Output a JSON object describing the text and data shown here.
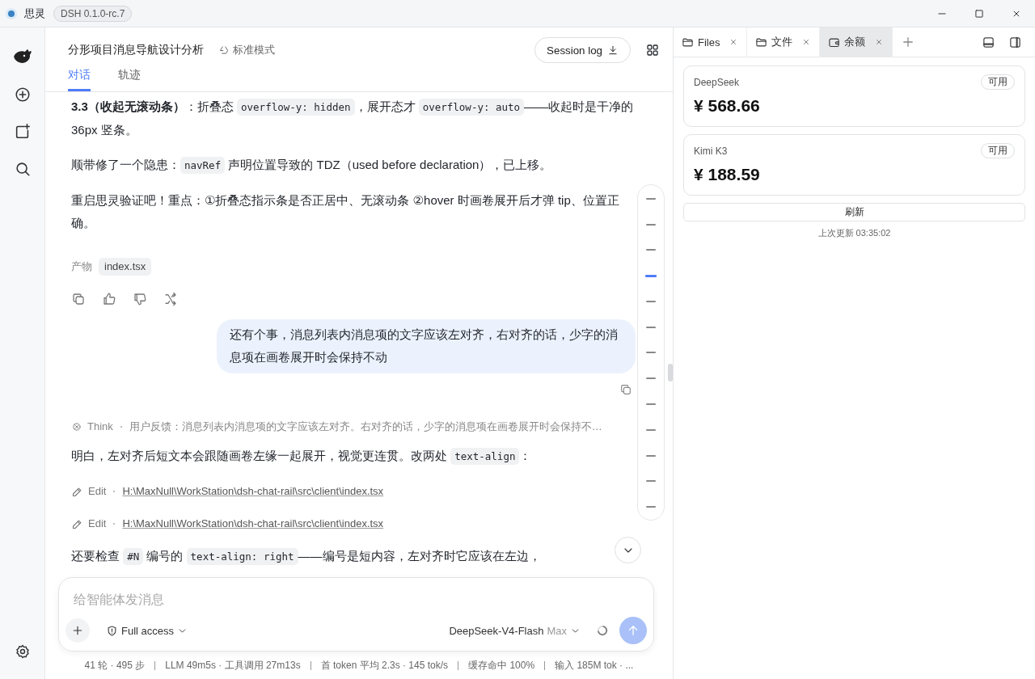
{
  "titlebar": {
    "app_name": "思灵",
    "version": "DSH 0.1.0-rc.7"
  },
  "header": {
    "title": "分形项目消息导航设计分析",
    "mode": "标准模式",
    "session_button": "Session log",
    "tabs": [
      {
        "label": "对话",
        "selected": true
      },
      {
        "label": "轨迹",
        "selected": false
      }
    ]
  },
  "messages": [
    {
      "kind": "paragraph",
      "parts": [
        {
          "kind": "text",
          "text": "**3.3（收起无滚动条）**：折叠态 "
        },
        {
          "kind": "code",
          "text": "overflow-y: hidden"
        },
        {
          "kind": "text",
          "text": "，展开态才 "
        },
        {
          "kind": "code",
          "text": "overflow-y: auto"
        },
        {
          "kind": "text",
          "text": "——收起时是干净的 36px 竖条。"
        }
      ]
    },
    {
      "kind": "paragraph",
      "parts": [
        {
          "kind": "text",
          "text": "顺带修了一个隐患："
        },
        {
          "kind": "code",
          "text": "navRef"
        },
        {
          "kind": "text",
          "text": " 声明位置导致的 TDZ（used before declaration），已上移。"
        }
      ]
    },
    {
      "kind": "paragraph",
      "parts": [
        {
          "kind": "text",
          "text": "重启思灵验证吧！重点：①折叠态指示条是否正居中、无滚动条 ②hover 时画卷展开后才弹 tip、位置正确。"
        }
      ]
    },
    {
      "kind": "artifacts",
      "label": "产物",
      "files": [
        "index.tsx"
      ]
    },
    {
      "kind": "actions"
    },
    {
      "kind": "user",
      "text": "还有个事，消息列表内消息项的文字应该左对齐，右对齐的话，少字的消息项在画卷展开时会保持不动"
    },
    {
      "kind": "think",
      "label": "Think",
      "text": "用户反馈：消息列表内消息项的文字应该左对齐。右对齐的话，少字的消息项在画卷展开时会保持不…"
    },
    {
      "kind": "paragraph",
      "parts": [
        {
          "kind": "text",
          "text": "明白，左对齐后短文本会跟随画卷左缘一起展开，视觉更连贯。改两处 "
        },
        {
          "kind": "code",
          "text": "text-align"
        },
        {
          "kind": "text",
          "text": "："
        }
      ]
    },
    {
      "kind": "edit",
      "label": "Edit",
      "path": "H:\\MaxNull\\WorkStation\\dsh-chat-rail\\src\\client\\index.tsx"
    },
    {
      "kind": "edit",
      "label": "Edit",
      "path": "H:\\MaxNull\\WorkStation\\dsh-chat-rail\\src\\client\\index.tsx"
    },
    {
      "kind": "paragraph",
      "parts": [
        {
          "kind": "text",
          "text": "还要检查 "
        },
        {
          "kind": "code",
          "text": "#N"
        },
        {
          "kind": "text",
          "text": " 编号的 "
        },
        {
          "kind": "code",
          "text": "text-align: right"
        },
        {
          "kind": "text",
          "text": "——编号是短内容，左对齐时它应该在左边，"
        }
      ]
    }
  ],
  "nav_rail": [
    {
      "selected": false
    },
    {
      "selected": false
    },
    {
      "selected": false
    },
    {
      "selected": true
    },
    {
      "selected": false
    },
    {
      "selected": false
    },
    {
      "selected": false
    },
    {
      "selected": false
    },
    {
      "selected": false
    },
    {
      "selected": false
    },
    {
      "selected": false
    },
    {
      "selected": false
    },
    {
      "selected": false
    }
  ],
  "composer": {
    "placeholder": "给智能体发消息",
    "access": "Full access",
    "model": "DeepSeek-V4-Flash",
    "effort": "Max",
    "busy": true
  },
  "status_bar": [
    "41 轮 · 495 步",
    "LLM 49m5s · 工具调用 27m13s",
    "首 token 平均 2.3s · 145 tok/s",
    "缓存命中 100%",
    "输入 185M tok · ..."
  ],
  "side_panel": {
    "tabs": [
      {
        "label": "Files",
        "kind": "folder",
        "selected": false
      },
      {
        "label": "文件",
        "kind": "folder",
        "selected": false
      },
      {
        "label": "余额",
        "kind": "wallet",
        "selected": true
      }
    ],
    "balances": [
      {
        "name": "DeepSeek",
        "status": "可用",
        "amount": "¥ 568.66"
      },
      {
        "name": "Kimi K3",
        "status": "可用",
        "amount": "¥ 188.59"
      }
    ],
    "refresh_button": "刷新",
    "updated": "上次更新 03:35:02"
  }
}
